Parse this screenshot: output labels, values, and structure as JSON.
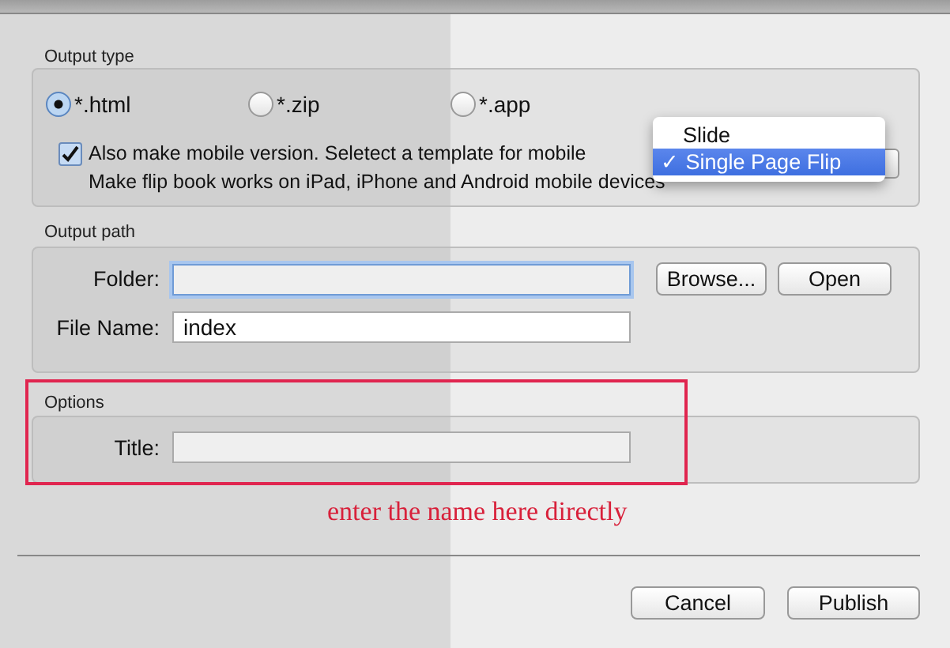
{
  "output_type": {
    "title": "Output type",
    "formats": [
      {
        "label": "*.html",
        "selected": true
      },
      {
        "label": "*.zip",
        "selected": false
      },
      {
        "label": "*.app",
        "selected": false
      }
    ],
    "mobile": {
      "checked": true,
      "label": "Also make mobile version. Seletect a template for mobile",
      "note": "Make flip book works on iPad, iPhone and Android mobile devices"
    },
    "template_menu": [
      {
        "label": "Slide",
        "selected": false
      },
      {
        "label": "Single Page Flip",
        "selected": true
      }
    ],
    "check_mark": "✓"
  },
  "output_path": {
    "title": "Output path",
    "folder": {
      "label": "Folder:",
      "focused": true
    },
    "buttons": [
      "Browse...",
      "Open"
    ],
    "file_name": {
      "label": "File Name:",
      "value": "index"
    }
  },
  "options": {
    "title": "Options",
    "highlighted": true,
    "title_field": {
      "label": "Title:"
    }
  },
  "annotation": "enter the name here directly",
  "footer_buttons": [
    "Cancel",
    "Publish"
  ]
}
